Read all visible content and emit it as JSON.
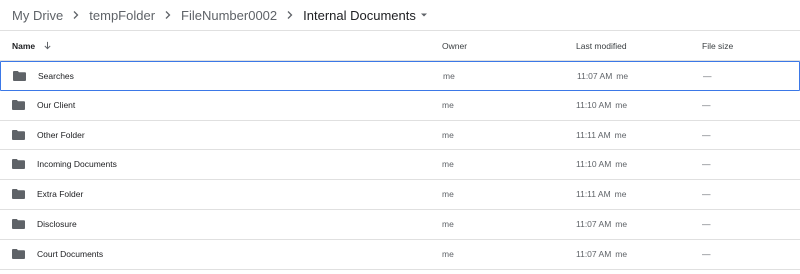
{
  "breadcrumb": {
    "items": [
      "My Drive",
      "tempFolder",
      "FileNumber0002",
      "Internal Documents"
    ]
  },
  "columns": {
    "name": "Name",
    "owner": "Owner",
    "modified": "Last modified",
    "size": "File size"
  },
  "files": [
    {
      "name": "Searches",
      "owner": "me",
      "time": "11:07 AM",
      "by": "me",
      "size": "—",
      "selected": true
    },
    {
      "name": "Our Client",
      "owner": "me",
      "time": "11:10 AM",
      "by": "me",
      "size": "—"
    },
    {
      "name": "Other Folder",
      "owner": "me",
      "time": "11:11 AM",
      "by": "me",
      "size": "—"
    },
    {
      "name": "Incoming Documents",
      "owner": "me",
      "time": "11:10 AM",
      "by": "me",
      "size": "—"
    },
    {
      "name": "Extra Folder",
      "owner": "me",
      "time": "11:11 AM",
      "by": "me",
      "size": "—"
    },
    {
      "name": "Disclosure",
      "owner": "me",
      "time": "11:07 AM",
      "by": "me",
      "size": "—"
    },
    {
      "name": "Court Documents",
      "owner": "me",
      "time": "11:07 AM",
      "by": "me",
      "size": "—"
    }
  ],
  "icons": {
    "folder": "folder-icon",
    "separator": "chevron-right-icon",
    "dropdown": "caret-down-icon",
    "sort": "arrow-down-icon"
  },
  "colors": {
    "selection_border": "#3b78e7",
    "folder": "#5f6368",
    "divider": "#e0e0e0"
  }
}
